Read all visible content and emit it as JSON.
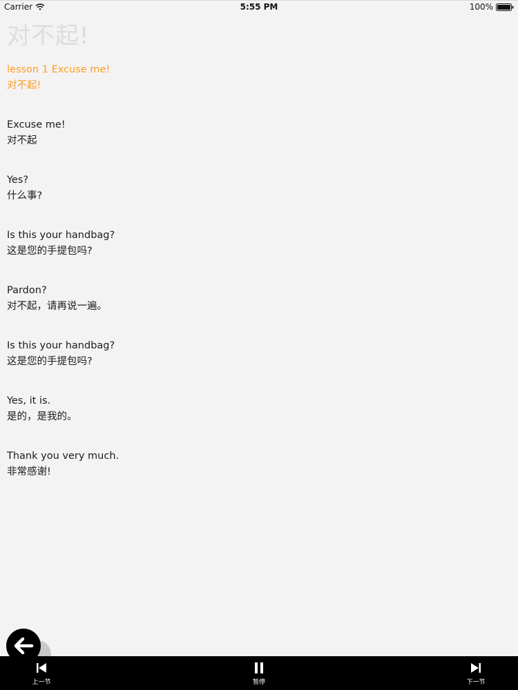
{
  "status_bar": {
    "carrier": "Carrier",
    "time": "5:55 PM",
    "battery": "100%"
  },
  "title": "对不起!",
  "accent_color": "#ff9c1f",
  "lines": [
    {
      "en": "lesson 1 Excuse me!",
      "cn": "对不起!",
      "current": true
    },
    {
      "en": "Excuse me!",
      "cn": "对不起"
    },
    {
      "en": "Yes?",
      "cn": "什么事?"
    },
    {
      "en": "Is this your handbag?",
      "cn": "这是您的手提包吗?"
    },
    {
      "en": "Pardon?",
      "cn": "对不起，请再说一遍。"
    },
    {
      "en": "Is this your handbag?",
      "cn": "这是您的手提包吗?"
    },
    {
      "en": "Yes, it is.",
      "cn": "是的，是我的。"
    },
    {
      "en": "Thank you very much.",
      "cn": "非常感谢!"
    }
  ],
  "back_button": {
    "icon": "arrow-left-icon"
  },
  "player": {
    "prev_label": "上一节",
    "pause_label": "暂停",
    "next_label": "下一节",
    "prev_icon": "skip-previous-icon",
    "pause_icon": "pause-icon",
    "next_icon": "skip-next-icon"
  }
}
